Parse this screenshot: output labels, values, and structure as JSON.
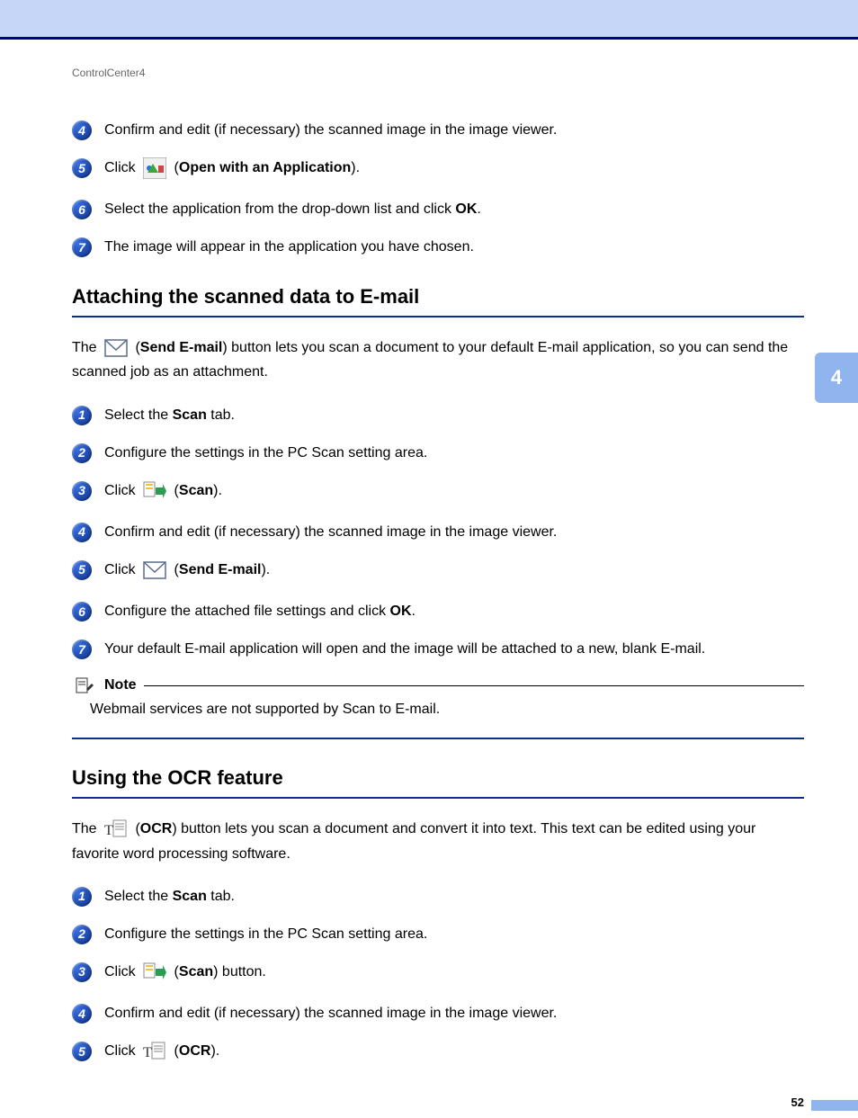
{
  "running_head": "ControlCenter4",
  "side_tab": "4",
  "page_number": "52",
  "top_steps": {
    "s4": {
      "num": "4",
      "text": "Confirm and edit (if necessary) the scanned image in the image viewer."
    },
    "s5": {
      "num": "5",
      "prefix": "Click ",
      "bold": "Open with an Application",
      "suffix": ")."
    },
    "s6": {
      "num": "6",
      "prefix": "Select the application from the drop-down list and click ",
      "bold": "OK",
      "suffix": "."
    },
    "s7": {
      "num": "7",
      "text": "The image will appear in the application you have chosen."
    }
  },
  "section_email": {
    "heading": "Attaching the scanned data to E-mail",
    "intro_prefix": "The ",
    "intro_bold": "Send E-mail",
    "intro_suffix": ") button lets you scan a document to your default E-mail application, so you can send the scanned job as an attachment.",
    "s1": {
      "num": "1",
      "prefix": "Select the ",
      "bold": "Scan",
      "suffix": " tab."
    },
    "s2": {
      "num": "2",
      "text": "Configure the settings in the PC Scan setting area."
    },
    "s3": {
      "num": "3",
      "prefix": "Click ",
      "bold": "Scan",
      "suffix": ")."
    },
    "s4": {
      "num": "4",
      "text": "Confirm and edit (if necessary) the scanned image in the image viewer."
    },
    "s5": {
      "num": "5",
      "prefix": "Click ",
      "bold": "Send E-mail",
      "suffix": ")."
    },
    "s6": {
      "num": "6",
      "prefix": "Configure the attached file settings and click ",
      "bold": "OK",
      "suffix": "."
    },
    "s7": {
      "num": "7",
      "text": "Your default E-mail application will open and the image will be attached to a new, blank E-mail."
    },
    "note_label": "Note",
    "note_body": "Webmail services are not supported by Scan to E-mail."
  },
  "section_ocr": {
    "heading": "Using the OCR feature",
    "intro_prefix": "The ",
    "intro_bold": "OCR",
    "intro_suffix": ") button lets you scan a document and convert it into text. This text can be edited using your favorite word processing software.",
    "s1": {
      "num": "1",
      "prefix": "Select the ",
      "bold": "Scan",
      "suffix": " tab."
    },
    "s2": {
      "num": "2",
      "text": "Configure the settings in the PC Scan setting area."
    },
    "s3": {
      "num": "3",
      "prefix": "Click ",
      "bold": "Scan",
      "suffix": ") button."
    },
    "s4": {
      "num": "4",
      "text": "Confirm and edit (if necessary) the scanned image in the image viewer."
    },
    "s5": {
      "num": "5",
      "prefix": "Click ",
      "bold": "OCR",
      "suffix": ")."
    }
  }
}
